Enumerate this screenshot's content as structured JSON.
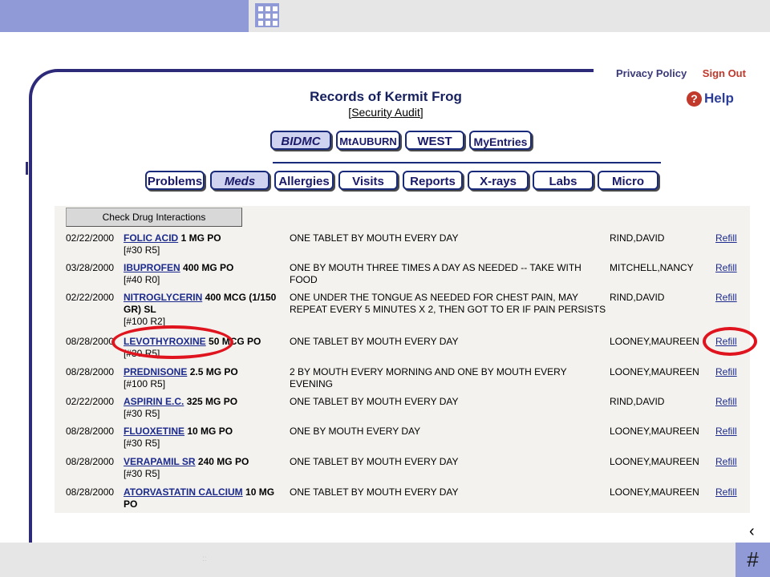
{
  "page": {
    "title": "Records of Kermit Frog",
    "audit_label": "Security Audit",
    "privacy_policy": "Privacy Policy",
    "sign_out": "Sign Out",
    "help": "Help",
    "help_icon_glyph": "?",
    "slide_number": "#",
    "prev_arrow": "‹",
    "footer_dots": "::"
  },
  "sites": [
    "BIDMC",
    "MtAUBURN",
    "WEST",
    "MyEntries"
  ],
  "selected_site": "BIDMC",
  "tabs": [
    "Problems",
    "Meds",
    "Allergies",
    "Visits",
    "Reports",
    "X-rays",
    "Labs",
    "Micro"
  ],
  "selected_tab": "Meds",
  "check_button": "Check Drug Interactions",
  "meds": [
    {
      "date": "02/22/2000",
      "name": "FOLIC ACID",
      "dose": "1 MG PO",
      "qty": "[#30 R5]",
      "sig": "ONE TABLET BY MOUTH EVERY DAY",
      "provider": "RIND,DAVID",
      "action": "Refill"
    },
    {
      "date": "03/28/2000",
      "name": "IBUPROFEN",
      "dose": "400 MG PO",
      "qty": "[#40 R0]",
      "sig": "ONE BY MOUTH THREE TIMES A DAY AS NEEDED -- TAKE WITH FOOD",
      "provider": "MITCHELL,NANCY",
      "action": "Refill"
    },
    {
      "date": "02/22/2000",
      "name": "NITROGLYCERIN",
      "dose": "400 MCG (1/150 GR) SL",
      "qty": "[#100 R2]",
      "sig": "ONE UNDER THE TONGUE AS NEEDED FOR CHEST PAIN, MAY REPEAT EVERY 5 MINUTES X 2, THEN GOT TO ER IF PAIN PERSISTS",
      "provider": "RIND,DAVID",
      "action": "Refill"
    },
    {
      "date": "08/28/2000",
      "name": "LEVOTHYROXINE",
      "dose": "50 MCG PO",
      "qty": "[#30 R5]",
      "sig": "ONE TABLET BY MOUTH EVERY DAY",
      "provider": "LOONEY,MAUREEN",
      "action": "Refill"
    },
    {
      "date": "08/28/2000",
      "name": "PREDNISONE",
      "dose": "2.5 MG PO",
      "qty": "[#100 R5]",
      "sig": "2 BY MOUTH EVERY MORNING AND ONE BY MOUTH EVERY EVENING",
      "provider": "LOONEY,MAUREEN",
      "action": "Refill"
    },
    {
      "date": "02/22/2000",
      "name": "ASPIRIN E.C.",
      "dose": "325 MG PO",
      "qty": "[#30 R5]",
      "sig": "ONE TABLET BY MOUTH EVERY DAY",
      "provider": "RIND,DAVID",
      "action": "Refill"
    },
    {
      "date": "08/28/2000",
      "name": "FLUOXETINE",
      "dose": "10 MG PO",
      "qty": "[#30 R5]",
      "sig": "ONE BY MOUTH EVERY DAY",
      "provider": "LOONEY,MAUREEN",
      "action": "Refill"
    },
    {
      "date": "08/28/2000",
      "name": "VERAPAMIL SR",
      "dose": "240 MG PO",
      "qty": "[#30 R5]",
      "sig": "ONE TABLET BY MOUTH EVERY DAY",
      "provider": "LOONEY,MAUREEN",
      "action": "Refill"
    },
    {
      "date": "08/28/2000",
      "name": "ATORVASTATIN CALCIUM",
      "dose": "10 MG PO",
      "qty": "",
      "sig": "ONE TABLET BY MOUTH EVERY DAY",
      "provider": "LOONEY,MAUREEN",
      "action": "Refill"
    }
  ],
  "colors": {
    "accent": "#8f9ad6",
    "navy": "#1a2a7a",
    "link": "#1b2a8c",
    "highlight": "#e0141e",
    "sign_out": "#c0392b"
  },
  "icons": {
    "grid": "grid-icon",
    "help": "help-icon"
  }
}
